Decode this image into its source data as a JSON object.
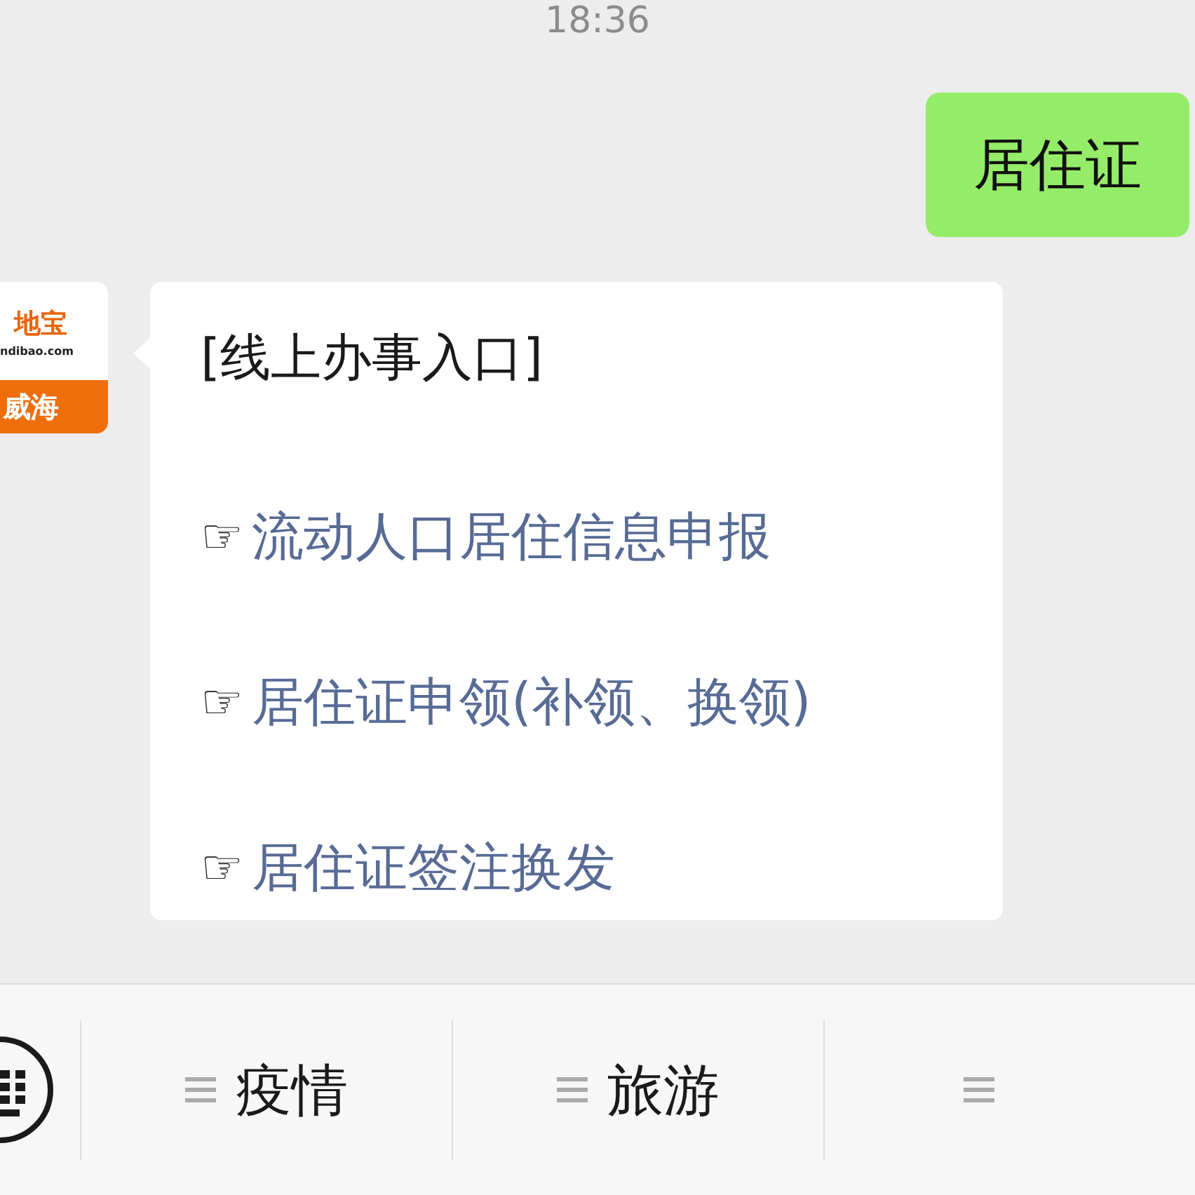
{
  "time": "18:36",
  "messages": [
    {
      "kind": "sent",
      "text": "居住证"
    },
    {
      "kind": "received",
      "avatar": {
        "brand": "地宝",
        "site": "ndibao.com",
        "city": "威海"
      },
      "title": "[线上办事入口]",
      "links": [
        {
          "marker": "☞",
          "text": "流动人口居住信息申报"
        },
        {
          "marker": "☞",
          "text": "居住证申领(补领、换领)"
        },
        {
          "marker": "☞",
          "text": "居住证签注换发"
        }
      ]
    }
  ],
  "menu": [
    {
      "label": "疫情",
      "cut_off": false
    },
    {
      "label": "旅游",
      "cut_off": false
    },
    {
      "cut_off": true
    }
  ]
}
